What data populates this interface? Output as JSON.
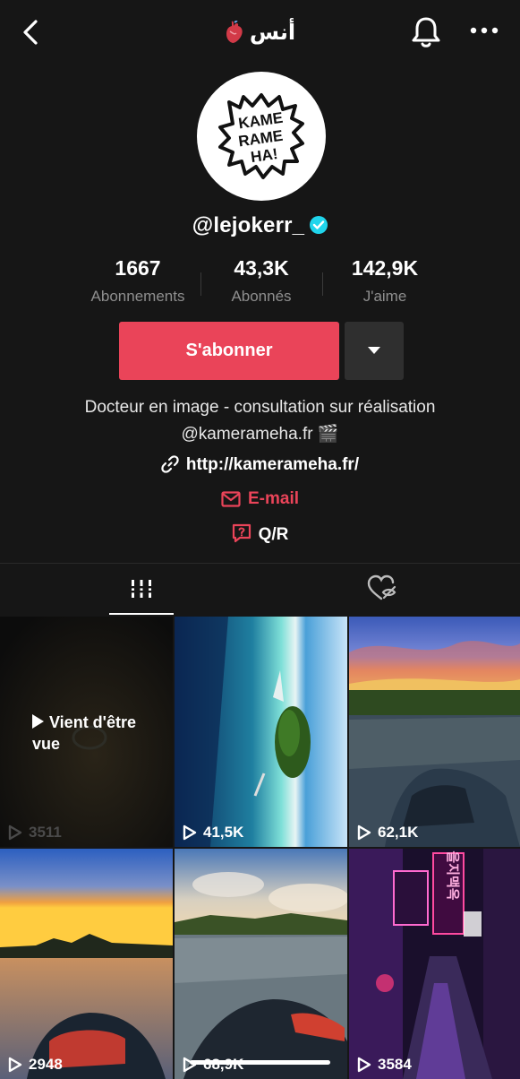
{
  "header": {
    "title": "أنس",
    "heart_emoji": "🫀"
  },
  "profile": {
    "avatar_text": [
      "KAME",
      "RAME",
      "HA!"
    ],
    "handle": "@lejokerr_",
    "verified": true
  },
  "stats": [
    {
      "value": "1667",
      "label": "Abonnements"
    },
    {
      "value": "43,3K",
      "label": "Abonnés"
    },
    {
      "value": "142,9K",
      "label": "J'aime"
    }
  ],
  "actions": {
    "follow_label": "S'abonner"
  },
  "bio": {
    "line1": "Docteur en image - consultation sur réalisation",
    "line2": "@kamerameha.fr 🎬",
    "link": "http://kamerameha.fr/",
    "email_label": "E-mail",
    "qa_label": "Q/R"
  },
  "videos": [
    {
      "views": "3511",
      "overlay_line1": "Vient d'être",
      "overlay_line2": "vue"
    },
    {
      "views": "41,5K"
    },
    {
      "views": "62,1K"
    },
    {
      "views": "2948"
    },
    {
      "views": "68,9K"
    },
    {
      "views": "3584",
      "sign_text": "을지맥옥"
    }
  ],
  "colors": {
    "accent": "#ea4459",
    "verified": "#20d5ec",
    "background": "#161616"
  }
}
